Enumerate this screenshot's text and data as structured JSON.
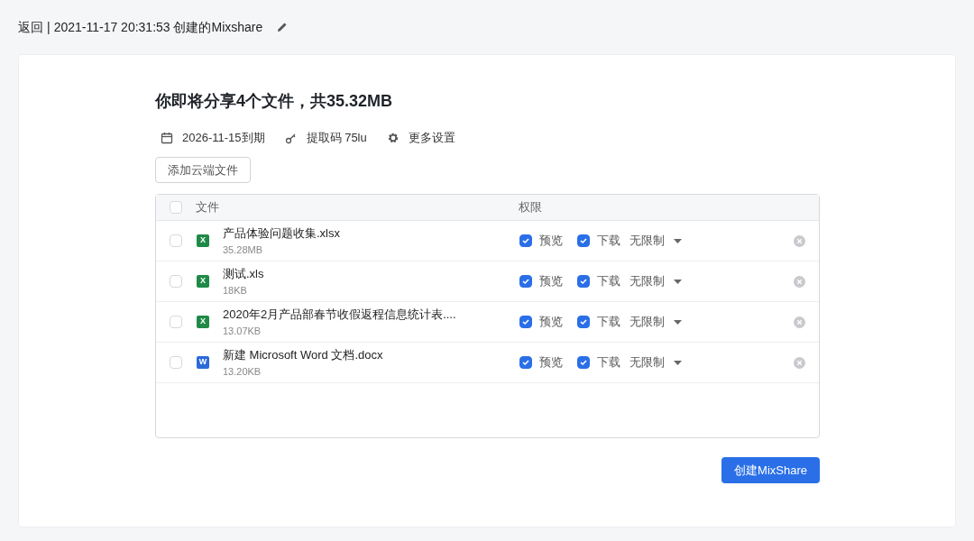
{
  "header": {
    "back": "返回",
    "separator": "|",
    "title": "2021-11-17 20:31:53 创建的Mixshare"
  },
  "summary": {
    "title": "你即将分享4个文件，共35.32MB"
  },
  "settings": [
    {
      "kind": "calendar",
      "label": "2026-11-15到期"
    },
    {
      "kind": "key",
      "label": "提取码 75lu"
    },
    {
      "kind": "gear",
      "label": "更多设置"
    }
  ],
  "add_button": "添加云端文件",
  "table": {
    "columns": [
      "文件",
      "权限"
    ],
    "all_checked": false,
    "rows": [
      {
        "checked": false,
        "kind": "excel",
        "icon_letter": "X",
        "name": "产品体验问题收集.xlsx",
        "size": "35.28MB",
        "preview": {
          "label": "预览",
          "checked": true
        },
        "download": {
          "label": "下载",
          "checked": true
        },
        "limit": "无限制"
      },
      {
        "checked": false,
        "kind": "excel",
        "icon_letter": "X",
        "name": "测试.xls",
        "size": "18KB",
        "preview": {
          "label": "预览",
          "checked": true
        },
        "download": {
          "label": "下载",
          "checked": true
        },
        "limit": "无限制"
      },
      {
        "checked": false,
        "kind": "excel",
        "icon_letter": "X",
        "name": "2020年2月产品部春节收假返程信息统计表....",
        "size": "13.07KB",
        "preview": {
          "label": "预览",
          "checked": true
        },
        "download": {
          "label": "下载",
          "checked": true
        },
        "limit": "无限制"
      },
      {
        "checked": false,
        "kind": "word",
        "icon_letter": "W",
        "name": "新建 Microsoft Word 文档.docx",
        "size": "13.20KB",
        "preview": {
          "label": "预览",
          "checked": true
        },
        "download": {
          "label": "下载",
          "checked": true
        },
        "limit": "无限制"
      }
    ]
  },
  "create_button": "创建MixShare"
}
